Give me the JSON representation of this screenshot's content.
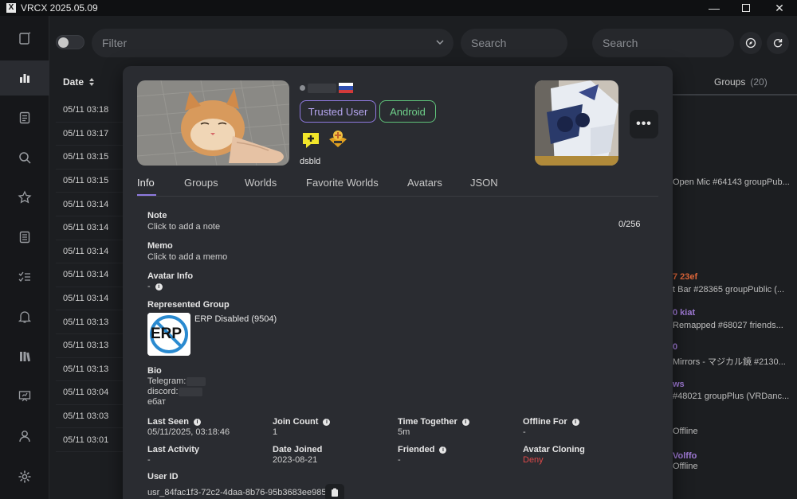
{
  "window": {
    "title": "VRCX 2025.05.09",
    "controls": [
      "minimize-icon",
      "maximize-icon",
      "close-icon"
    ]
  },
  "sidebar": {
    "items": [
      "notebook-icon",
      "chart-icon",
      "document-icon",
      "search-icon",
      "star-icon",
      "list-icon",
      "checklist-icon",
      "bell-icon",
      "library-icon",
      "presentation-icon",
      "user-icon",
      "gear-icon"
    ],
    "active": "chart-icon"
  },
  "toolbar": {
    "filter_placeholder": "Filter",
    "search_placeholder": "Search",
    "search2_placeholder": "Search"
  },
  "feed": {
    "date_header": "Date",
    "dates": [
      "05/11 03:18",
      "05/11 03:17",
      "05/11 03:15",
      "05/11 03:15",
      "05/11 03:14",
      "05/11 03:14",
      "05/11 03:14",
      "05/11 03:14",
      "05/11 03:14",
      "05/11 03:13",
      "05/11 03:13",
      "05/11 03:13",
      "05/11 03:04",
      "05/11 03:03",
      "05/11 03:01"
    ]
  },
  "right_panel": {
    "groups_label": "Groups",
    "groups_count": "(20)",
    "lines": [
      "Open Mic #64143 groupPub...",
      "7 23ef",
      "t Bar #28365 groupPublic (...",
      "0 kiat",
      "Remapped #68027 friends...",
      "0",
      "Mirrors - マジカル鏡 #2130...",
      "ws",
      "#48021 groupPlus (VRDanc...",
      "Offline",
      "Volffo",
      "Offline"
    ]
  },
  "dialog": {
    "tags": {
      "trusted": "Trusted User",
      "platform": "Android"
    },
    "status_desc": "dsbld",
    "more_label": "•••",
    "tabs": [
      "Info",
      "Groups",
      "Worlds",
      "Favorite Worlds",
      "Avatars",
      "JSON"
    ],
    "note": {
      "label": "Note",
      "value": "Click to add a note",
      "counter": "0/256"
    },
    "memo": {
      "label": "Memo",
      "value": "Click to add a memo"
    },
    "avatar_info": {
      "label": "Avatar Info",
      "value": "-"
    },
    "represented_group": {
      "label": "Represented Group",
      "name": "ERP Disabled",
      "count": "(9504)",
      "icon_text": "ERP"
    },
    "bio": {
      "label": "Bio",
      "lines": [
        "Telegram:",
        "discord:",
        "ебат"
      ]
    },
    "stats": {
      "last_seen": {
        "label": "Last Seen",
        "value": "05/11/2025, 03:18:46"
      },
      "join_count": {
        "label": "Join Count",
        "value": "1"
      },
      "time_together": {
        "label": "Time Together",
        "value": "5m"
      },
      "offline_for": {
        "label": "Offline For",
        "value": "-"
      },
      "last_activity": {
        "label": "Last Activity",
        "value": "-"
      },
      "date_joined": {
        "label": "Date Joined",
        "value": "2023-08-21"
      },
      "friended": {
        "label": "Friended",
        "value": "-"
      },
      "avatar_cloning": {
        "label": "Avatar Cloning",
        "value": "Deny"
      }
    },
    "user_id": {
      "label": "User ID",
      "value": "usr_84fac1f3-72c2-4daa-8b76-95b3683ee985"
    }
  },
  "colors": {
    "accent": "#8f7ae0",
    "android": "#5fc27a",
    "deny": "#e04a4a",
    "background": "#1c1e21",
    "dialog": "#2a2c31"
  }
}
